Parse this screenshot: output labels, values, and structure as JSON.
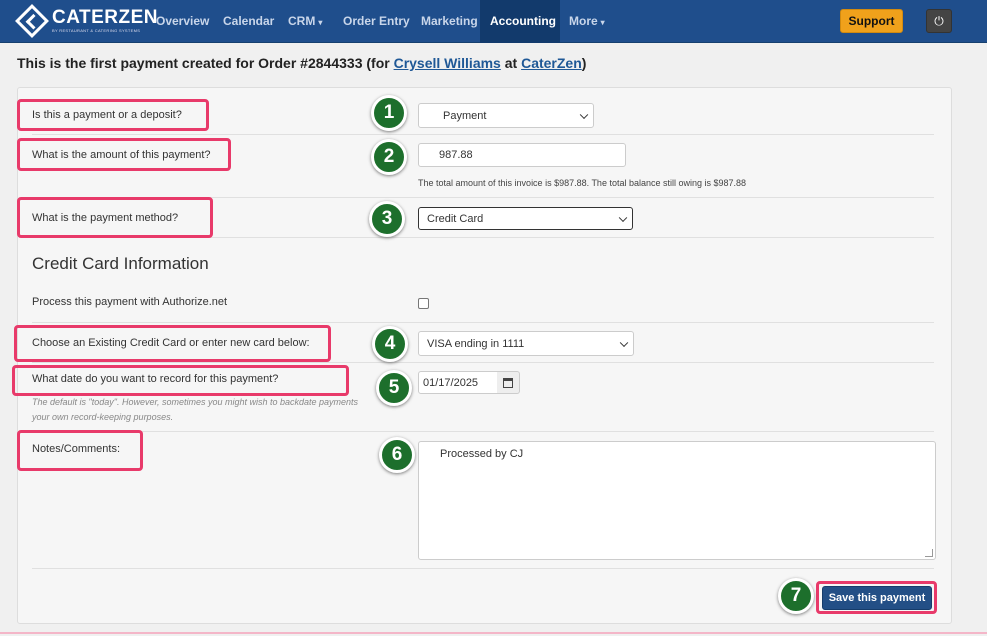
{
  "nav": {
    "brand": "CATERZEN",
    "brand_sub": "BY RESTAURANT & CATERING SYSTEMS",
    "items": [
      {
        "label": "Overview"
      },
      {
        "label": "Calendar"
      },
      {
        "label": "CRM",
        "dropdown": true
      },
      {
        "label": "Order Entry"
      },
      {
        "label": "Marketing"
      },
      {
        "label": "Accounting",
        "active": true
      },
      {
        "label": "More",
        "dropdown": true
      }
    ],
    "caret": "▾",
    "support": "Support",
    "power_icon": "⏻"
  },
  "heading": {
    "prefix": "This is the first payment created for Order #2844333 (for ",
    "customer": "Crysell Williams",
    "mid": " at ",
    "company": "CaterZen",
    "suffix": ")"
  },
  "form": {
    "type": {
      "label": "Is this a payment or a deposit?",
      "value": "Payment",
      "badge": "1"
    },
    "amount": {
      "label": "What is the amount of this payment?",
      "value": "987.88",
      "badge": "2",
      "hint": "The total amount of this invoice is $987.88. The total balance still owing is $987.88"
    },
    "method": {
      "label": "What is the payment method?",
      "value": "Credit Card",
      "badge": "3"
    },
    "cc_section": "Credit Card Information",
    "authorize": {
      "label": "Process this payment with Authorize.net",
      "checked": false
    },
    "card": {
      "label": "Choose an Existing Credit Card or enter new card below:",
      "value": "VISA ending in 1111",
      "badge": "4"
    },
    "date": {
      "label": "What date do you want to record for this payment?",
      "value": "01/17/2025",
      "badge": "5",
      "hint_line1": "The default is \"today\". However, sometimes you might wish to backdate payments",
      "hint_line2": "your own record-keeping purposes."
    },
    "notes": {
      "label": "Notes/Comments:",
      "value": "Processed by CJ",
      "badge": "6"
    },
    "save": {
      "label": "Save this payment",
      "badge": "7"
    }
  },
  "colors": {
    "navbar": "#1f4e8c",
    "support": "#f0a11b",
    "highlight": "#e83a6a",
    "badge": "#1d6f2c",
    "save": "#234f86"
  }
}
